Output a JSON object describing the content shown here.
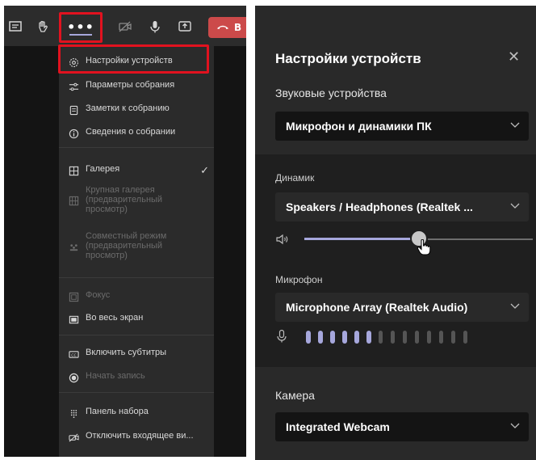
{
  "toolbar": {
    "icons": [
      "chat-icon",
      "raise-hand-icon",
      "more-icon",
      "camera-off-icon",
      "microphone-icon",
      "share-screen-icon"
    ],
    "more_label": "•••",
    "leave_label": "В"
  },
  "menu": {
    "items": [
      {
        "label": "Настройки устройств",
        "icon": "gear-icon",
        "enabled": true
      },
      {
        "label": "Параметры собрания",
        "icon": "sliders-icon",
        "enabled": true
      },
      {
        "label": "Заметки к собранию",
        "icon": "notes-icon",
        "enabled": true
      },
      {
        "label": "Сведения о собрании",
        "icon": "info-icon",
        "enabled": true
      },
      {
        "label": "Галерея",
        "icon": "gallery-icon",
        "enabled": true,
        "checked": true
      },
      {
        "label": "Крупная галерея\n(предварительный\nпросмотр)",
        "icon": "large-gallery-icon",
        "enabled": false
      },
      {
        "label": "Совместный режим\n(предварительный\nпросмотр)",
        "icon": "together-mode-icon",
        "enabled": false
      },
      {
        "label": "Фокус",
        "icon": "focus-icon",
        "enabled": false
      },
      {
        "label": "Во весь экран",
        "icon": "fullscreen-icon",
        "enabled": true
      },
      {
        "label": "Включить субтитры",
        "icon": "captions-icon",
        "enabled": true
      },
      {
        "label": "Начать запись",
        "icon": "record-icon",
        "enabled": false
      },
      {
        "label": "Панель набора",
        "icon": "dialpad-icon",
        "enabled": true
      },
      {
        "label": "Отключить входящее ви...",
        "icon": "video-off-icon",
        "enabled": true
      }
    ],
    "check_mark": "✓"
  },
  "settings": {
    "title": "Настройки устройств",
    "close_label": "✕",
    "audio_devices_label": "Звуковые устройства",
    "audio_device_value": "Микрофон и динамики ПК",
    "speaker_label": "Динамик",
    "speaker_value": "Speakers / Headphones (Realtek ...",
    "speaker_volume": 0.5,
    "microphone_label": "Микрофон",
    "microphone_value": "Microphone Array (Realtek Audio)",
    "mic_level_bars": 14,
    "mic_level_active": 6,
    "camera_label": "Камера",
    "camera_value": "Integrated Webcam"
  },
  "colors": {
    "accent": "#a6a7dc",
    "highlight": "#e1121f",
    "leave": "#cc4a4a"
  }
}
